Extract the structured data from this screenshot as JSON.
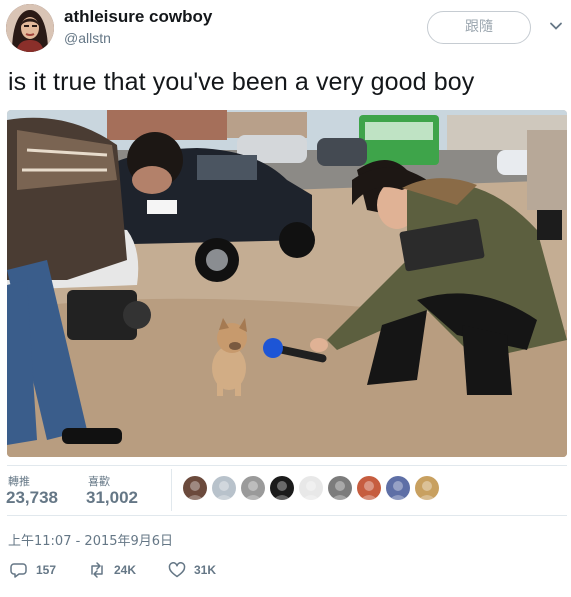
{
  "author": {
    "display_name": "athleisure cowboy",
    "handle": "@allstn",
    "avatar_icon": "profile-avatar-icon"
  },
  "header": {
    "follow_label": "跟隨",
    "more_icon": "chevron-down-icon"
  },
  "tweet": {
    "text": "is it true that you've been a very good boy",
    "image_icon": "tweet-photo-reporter-puppy"
  },
  "stats": {
    "retweets_label": "轉推",
    "retweets_value": "23,738",
    "likes_label": "喜歡",
    "likes_value": "31,002",
    "likers": [
      {
        "icon": "liker-avatar-icon",
        "color": "#6b4a3c"
      },
      {
        "icon": "liker-avatar-icon",
        "color": "#b8c2cb"
      },
      {
        "icon": "liker-avatar-icon",
        "color": "#9a9a9a"
      },
      {
        "icon": "liker-avatar-icon",
        "color": "#1b1b1b"
      },
      {
        "icon": "liker-avatar-icon",
        "color": "#e8e8e8"
      },
      {
        "icon": "liker-avatar-icon",
        "color": "#7c7c7c"
      },
      {
        "icon": "liker-avatar-icon",
        "color": "#c65d3f"
      },
      {
        "icon": "liker-avatar-icon",
        "color": "#5e6fa6"
      },
      {
        "icon": "liker-avatar-icon",
        "color": "#c8a060"
      }
    ]
  },
  "timestamp": "上午11:07 - 2015年9月6日",
  "actions": {
    "reply_icon": "reply-icon",
    "reply_count": "157",
    "retweet_icon": "retweet-icon",
    "retweet_count": "24K",
    "like_icon": "heart-icon",
    "like_count": "31K"
  },
  "colors": {
    "text": "#14171a",
    "secondary": "#657786",
    "border": "#e1e8ed"
  }
}
